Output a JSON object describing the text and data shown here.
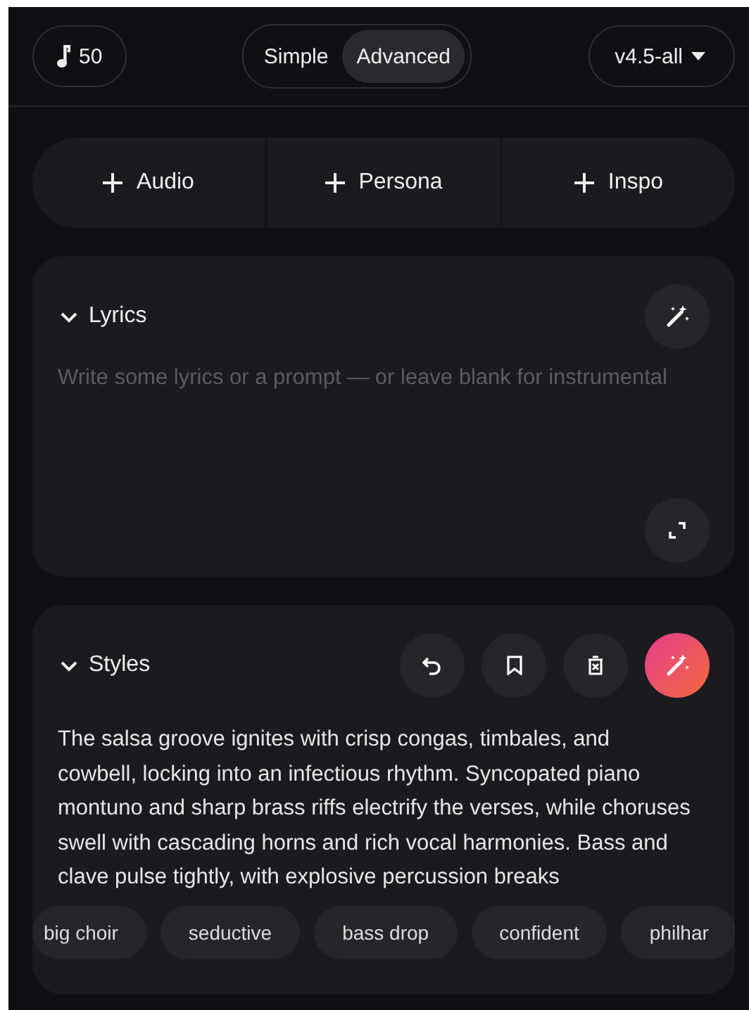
{
  "header": {
    "credits": "50",
    "modes": [
      {
        "label": "Simple",
        "selected": false
      },
      {
        "label": "Advanced",
        "selected": true
      }
    ],
    "model": "v4.5-all"
  },
  "add_buttons": [
    {
      "label": "Audio"
    },
    {
      "label": "Persona"
    },
    {
      "label": "Inspo"
    }
  ],
  "lyrics": {
    "title": "Lyrics",
    "expanded": true,
    "placeholder": "Write some lyrics or a prompt — or leave blank for instrumental"
  },
  "styles": {
    "title": "Styles",
    "expanded": true,
    "text": "The salsa groove ignites with crisp congas, timbales, and cowbell, locking into an infectious rhythm. Syncopated piano montuno and sharp brass riffs electrify the verses, while choruses swell with cascading horns and rich vocal harmonies. Bass and clave pulse tightly, with explosive percussion breaks",
    "tags": [
      "big choir",
      "seductive",
      "bass drop",
      "confident",
      "philhar"
    ]
  }
}
